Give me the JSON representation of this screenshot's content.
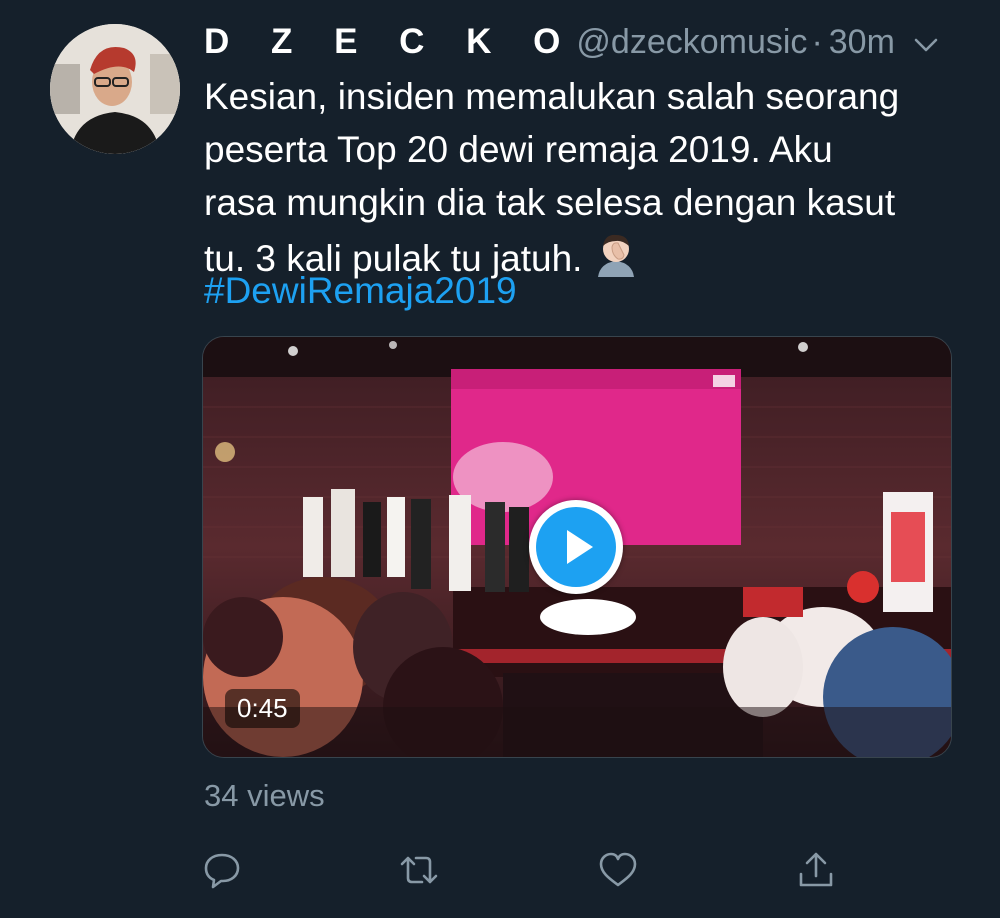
{
  "tweet": {
    "display_name": "D Z E C K O",
    "handle": "@dzeckomusic",
    "separator": "·",
    "timestamp": "30m",
    "text_lines": [
      "Kesian, insiden memalukan salah seorang",
      "peserta Top 20 dewi remaja 2019. Aku",
      "rasa mungkin dia tak selesa dengan kasut",
      "tu. 3 kali pulak tu jatuh."
    ],
    "hashtag": "#DewiRemaja2019",
    "emoji": "man-facepalming-emoji"
  },
  "media": {
    "type": "video",
    "duration": "0:45",
    "play_icon": "play-icon"
  },
  "stats": {
    "views": "34 views"
  },
  "actions": {
    "icons": [
      "reply-icon",
      "retweet-icon",
      "like-icon",
      "share-icon"
    ]
  },
  "colors": {
    "background": "#15202b",
    "text_primary": "#ffffff",
    "text_secondary": "#8899a6",
    "accent": "#1da1f2"
  }
}
